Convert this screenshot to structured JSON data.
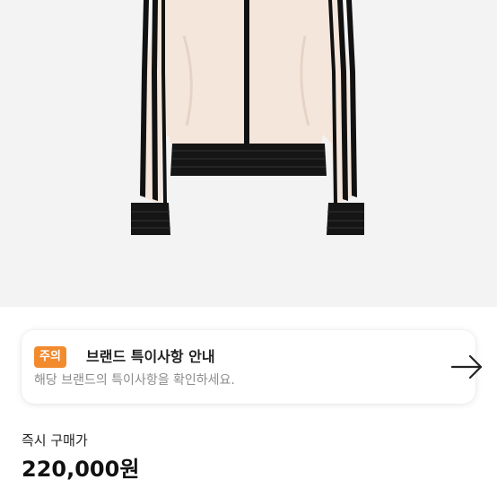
{
  "product": {
    "image_icon": "track-jacket-image",
    "image_background": "#f3f3f4"
  },
  "notice": {
    "badge": "주의",
    "badge_color": "#f28a2e",
    "title": "브랜드 특이사항 안내",
    "description": "해당 브랜드의 특이사항을 확인하세요.",
    "action_icon": "arrow-right-icon"
  },
  "price": {
    "label": "즉시 구매가",
    "value": "220,000원"
  }
}
